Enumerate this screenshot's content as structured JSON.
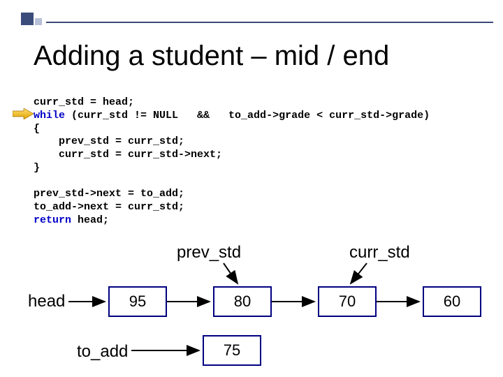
{
  "title": "Adding a student – mid / end",
  "code": {
    "l1": "curr_std = head;",
    "kw_while": "while",
    "l2_rest": " (curr_std != NULL   &&   to_add->grade < curr_std->grade)",
    "l3": "{",
    "l4": "    prev_std = curr_std;",
    "l5": "    curr_std = curr_std->next;",
    "l6": "}",
    "blank": "",
    "l8": "prev_std->next = to_add;",
    "l9": "to_add->next = curr_std;",
    "kw_return": "return",
    "l10_rest": " head;"
  },
  "labels": {
    "prev_std": "prev_std",
    "curr_std": "curr_std",
    "head": "head",
    "to_add": "to_add"
  },
  "nodes": {
    "n95": "95",
    "n80": "80",
    "n70": "70",
    "n60": "60",
    "n75": "75"
  }
}
